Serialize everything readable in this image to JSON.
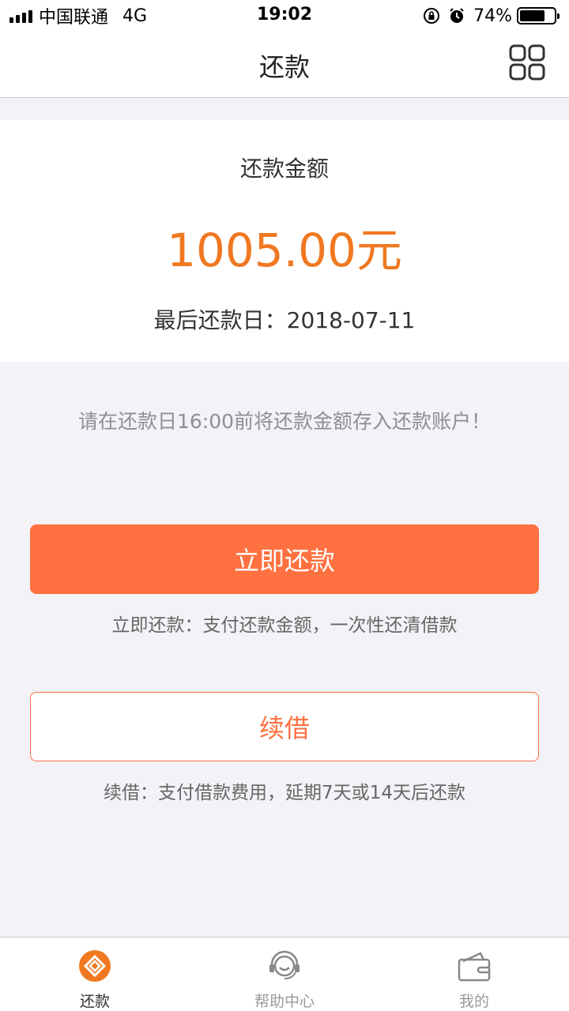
{
  "status_bar": {
    "carrier": "中国联通",
    "network": "4G",
    "time": "19:02",
    "battery_text": "74%",
    "battery_level": 0.74
  },
  "nav": {
    "title": "还款",
    "menu_icon": "grid-icon"
  },
  "repayment": {
    "amount_label": "还款金额",
    "amount": "1005.00元",
    "due_date_label": "最后还款日：",
    "due_date": "2018-07-11"
  },
  "notice": "请在还款日16:00前将还款金额存入还款账户！",
  "actions": {
    "repay_now_label": "立即还款",
    "repay_now_desc": "立即还款：支付还款金额，一次性还清借款",
    "renew_label": "续借",
    "renew_desc": "续借：支付借款费用，延期7天或14天后还款"
  },
  "tabs": [
    {
      "label": "还款",
      "icon": "repay-icon",
      "active": true
    },
    {
      "label": "帮助中心",
      "icon": "customer-service-icon",
      "active": false
    },
    {
      "label": "我的",
      "icon": "wallet-icon",
      "active": false
    }
  ],
  "colors": {
    "accent": "#ff7140",
    "amount": "#f07820",
    "background": "#f2f2f7"
  }
}
